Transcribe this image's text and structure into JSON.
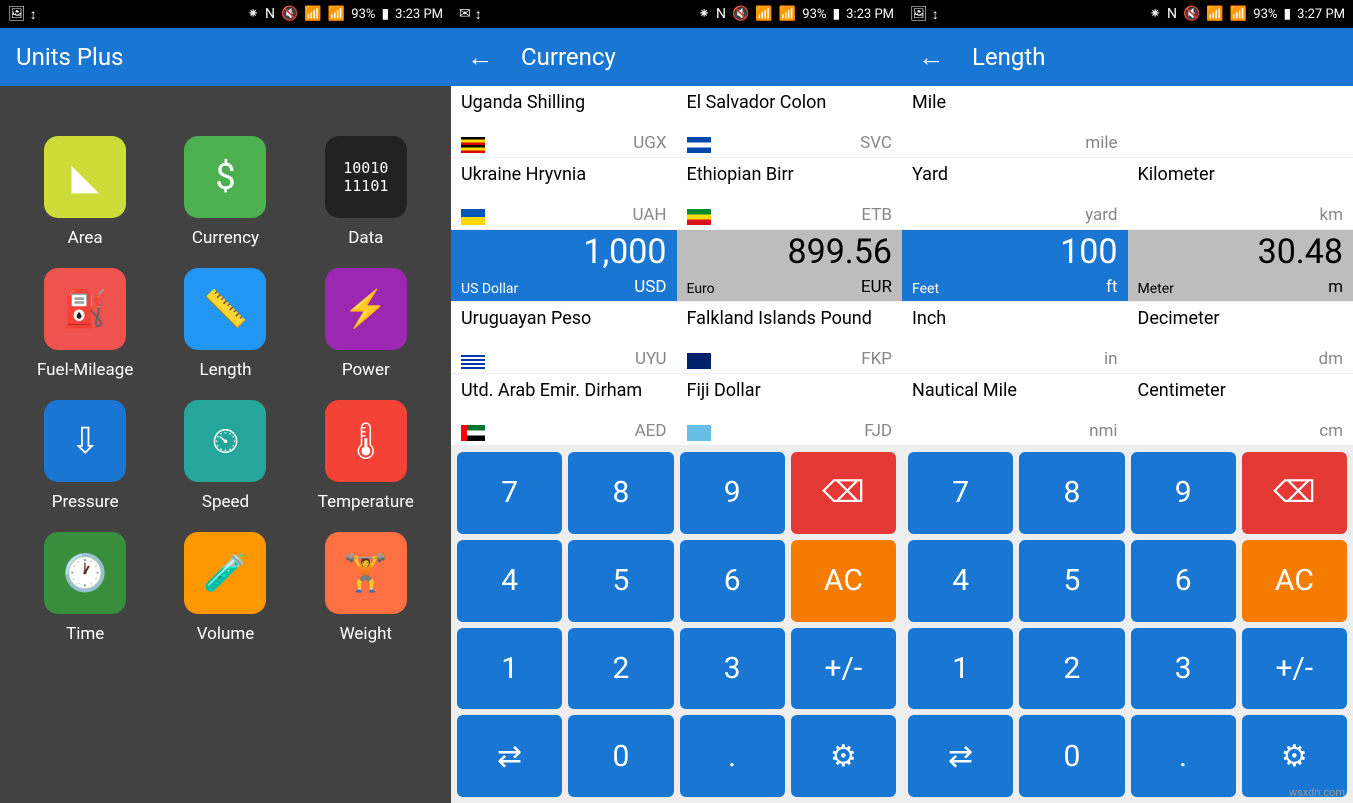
{
  "status": {
    "left_icons": [
      "🖼",
      "↕"
    ],
    "left_icons_b": [
      "✉",
      "↕"
    ],
    "right_text": "93%",
    "time_a": "3:23 PM",
    "time_c": "3:27 PM",
    "bt": "⁕",
    "nfc": "N",
    "mute": "🔇",
    "wifi": "📶",
    "sig": "📶",
    "bat": "▮"
  },
  "phone1": {
    "title": "Units Plus",
    "categories": [
      {
        "label": "Area",
        "icon": "◣",
        "bg": "#cddc39"
      },
      {
        "label": "Currency",
        "icon": "$",
        "bg": "#4caf50"
      },
      {
        "label": "Data",
        "icon": "10010\n11101",
        "bg": "#212121",
        "small": true
      },
      {
        "label": "Fuel-Mileage",
        "icon": "⛽",
        "bg": "#ef5350"
      },
      {
        "label": "Length",
        "icon": "📏",
        "bg": "#2196f3"
      },
      {
        "label": "Power",
        "icon": "⚡",
        "bg": "#9c27b0"
      },
      {
        "label": "Pressure",
        "icon": "⇩",
        "bg": "#1976d2"
      },
      {
        "label": "Speed",
        "icon": "⏲",
        "bg": "#26a69a"
      },
      {
        "label": "Temperature",
        "icon": "🌡",
        "bg": "#f44336"
      },
      {
        "label": "Time",
        "icon": "🕐",
        "bg": "#388e3c"
      },
      {
        "label": "Volume",
        "icon": "🧪",
        "bg": "#ff9800"
      },
      {
        "label": "Weight",
        "icon": "🏋",
        "bg": "#ff7043"
      }
    ]
  },
  "phone2": {
    "title": "Currency",
    "left": [
      {
        "name": "Uganda Shilling",
        "abbr": "UGX",
        "flag": "flag-ug"
      },
      {
        "name": "Ukraine Hryvnia",
        "abbr": "UAH",
        "flag": "flag-ua"
      },
      {
        "name": "US Dollar",
        "abbr": "USD",
        "value": "1,000",
        "selected": true
      },
      {
        "name": "Uruguayan Peso",
        "abbr": "UYU",
        "flag": "flag-uy"
      },
      {
        "name": "Utd. Arab Emir. Dirham",
        "abbr": "AED",
        "flag": "flag-ae"
      }
    ],
    "right": [
      {
        "name": "El Salvador Colon",
        "abbr": "SVC",
        "flag": "flag-sv"
      },
      {
        "name": "Ethiopian Birr",
        "abbr": "ETB",
        "flag": "flag-et"
      },
      {
        "name": "Euro",
        "abbr": "EUR",
        "value": "899.56",
        "result": true
      },
      {
        "name": "Falkland Islands Pound",
        "abbr": "FKP",
        "flag": "flag-fk"
      },
      {
        "name": "Fiji Dollar",
        "abbr": "FJD",
        "flag": "flag-fj"
      }
    ]
  },
  "phone3": {
    "title": "Length",
    "left": [
      {
        "name": "Mile",
        "abbr": "mile"
      },
      {
        "name": "Yard",
        "abbr": "yard"
      },
      {
        "name": "Feet",
        "abbr": "ft",
        "value": "100",
        "selected": true
      },
      {
        "name": "Inch",
        "abbr": "in"
      },
      {
        "name": "Nautical Mile",
        "abbr": "nmi"
      }
    ],
    "right": [
      {
        "name": "Kilometer",
        "abbr": "km"
      },
      {
        "name": "",
        "abbr": ""
      },
      {
        "name": "Meter",
        "abbr": "m",
        "value": "30.48",
        "result": true
      },
      {
        "name": "Decimeter",
        "abbr": "dm"
      },
      {
        "name": "Centimeter",
        "abbr": "cm"
      }
    ]
  },
  "keypad": [
    {
      "t": "7"
    },
    {
      "t": "8"
    },
    {
      "t": "9"
    },
    {
      "t": "⌫",
      "c": "red"
    },
    {
      "t": "4"
    },
    {
      "t": "5"
    },
    {
      "t": "6"
    },
    {
      "t": "AC",
      "c": "orange"
    },
    {
      "t": "1"
    },
    {
      "t": "2"
    },
    {
      "t": "3"
    },
    {
      "t": "+/-"
    },
    {
      "t": "⇄"
    },
    {
      "t": "0"
    },
    {
      "t": "."
    },
    {
      "t": "⚙"
    }
  ],
  "watermark": "wsxdn.com"
}
